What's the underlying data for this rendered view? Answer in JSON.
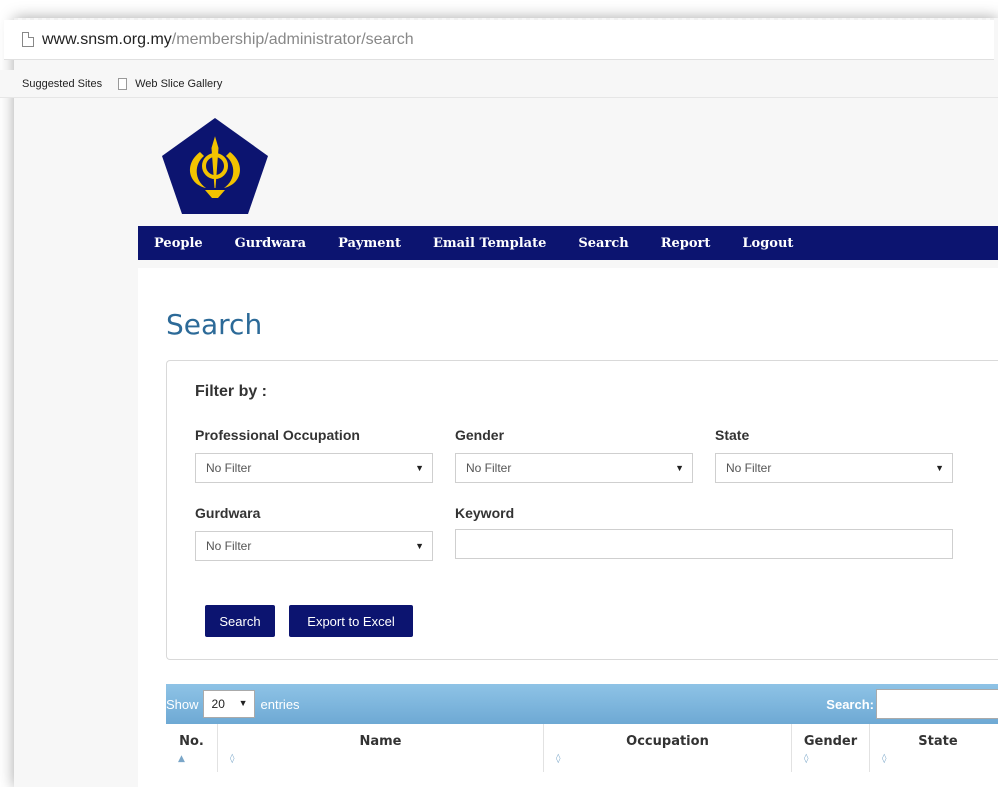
{
  "browser": {
    "url_host": "www.snsm.org.my",
    "url_path": "/membership/administrator/search",
    "favorites": [
      "Suggested Sites",
      "Web Slice Gallery"
    ]
  },
  "nav": {
    "items": [
      "People",
      "Gurdwara",
      "Payment",
      "Email Template",
      "Search",
      "Report",
      "Logout"
    ]
  },
  "page": {
    "title": "Search"
  },
  "filter": {
    "title": "Filter by :",
    "occupation_label": "Professional Occupation",
    "occupation_value": "No Filter",
    "gender_label": "Gender",
    "gender_value": "No Filter",
    "state_label": "State",
    "state_value": "No Filter",
    "gurdwara_label": "Gurdwara",
    "gurdwara_value": "No Filter",
    "keyword_label": "Keyword",
    "keyword_value": ""
  },
  "buttons": {
    "search": "Search",
    "export": "Export to Excel"
  },
  "table": {
    "show_label": "Show",
    "entries_value": "20",
    "entries_label": "entries",
    "search_label": "Search:",
    "columns": [
      "No.",
      "Name",
      "Occupation",
      "Gender",
      "State"
    ]
  },
  "colors": {
    "nav_bg": "#0c1470",
    "title": "#2c6a98",
    "table_bar": "#7db6de"
  }
}
